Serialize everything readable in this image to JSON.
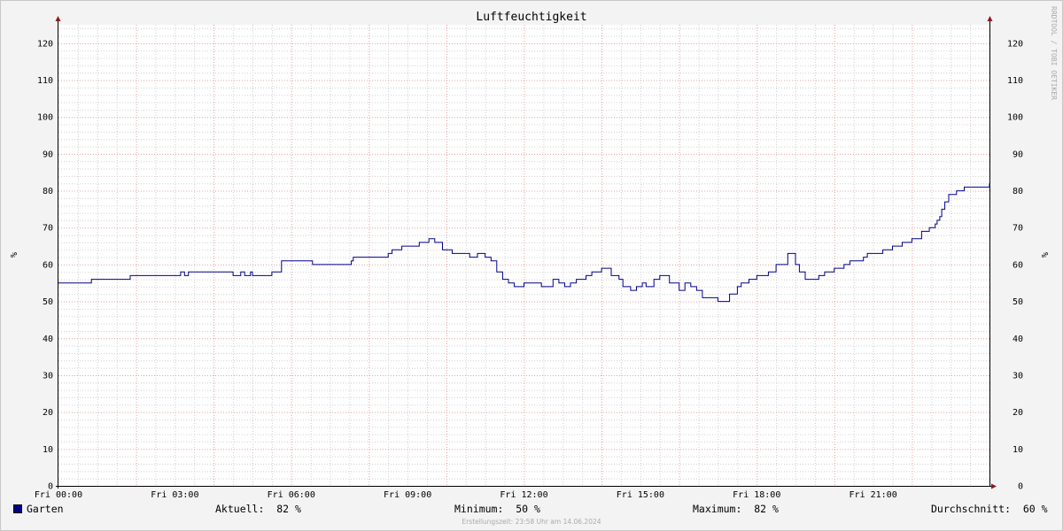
{
  "colors": {
    "background": "#f3f3f3",
    "canvas": "#ffffff",
    "major_grid": "#e6a0a0",
    "minor_grid": "#d0d0d0",
    "axis": "#000000",
    "series": "#00008b",
    "arrow": "#8b1a1a"
  },
  "watermark": "RRDTOOL / TOBI OETIKER",
  "chart_data": {
    "type": "line",
    "title": "Luftfeuchtigkeit",
    "ylabel": "%",
    "ylabel_right": "%",
    "ylim": [
      0,
      125
    ],
    "yticks": [
      0,
      10,
      20,
      30,
      40,
      50,
      60,
      70,
      80,
      90,
      100,
      110,
      120
    ],
    "xlim": [
      0,
      24
    ],
    "xticks": [
      {
        "h": 0,
        "label": "Fri 00:00"
      },
      {
        "h": 3,
        "label": "Fri 03:00"
      },
      {
        "h": 6,
        "label": "Fri 06:00"
      },
      {
        "h": 9,
        "label": "Fri 09:00"
      },
      {
        "h": 12,
        "label": "Fri 12:00"
      },
      {
        "h": 15,
        "label": "Fri 15:00"
      },
      {
        "h": 18,
        "label": "Fri 18:00"
      },
      {
        "h": 21,
        "label": "Fri 21:00"
      }
    ],
    "grid": true,
    "legend_position": "bottom",
    "series": [
      {
        "name": "Garten",
        "color": "#00008b",
        "x": [
          0,
          0.85,
          1.85,
          3.15,
          3.25,
          3.35,
          4.5,
          4.7,
          4.8,
          4.95,
          5.0,
          5.1,
          5.5,
          5.75,
          6.0,
          6.55,
          7.55,
          7.6,
          8.5,
          8.6,
          8.85,
          9.3,
          9.55,
          9.7,
          9.9,
          10.15,
          10.6,
          10.8,
          11.0,
          11.15,
          11.3,
          11.45,
          11.6,
          11.75,
          12.0,
          12.15,
          12.45,
          12.75,
          12.9,
          13.05,
          13.2,
          13.35,
          13.6,
          13.75,
          14.0,
          14.25,
          14.45,
          14.55,
          14.75,
          14.9,
          15.05,
          15.15,
          15.35,
          15.5,
          15.75,
          16.0,
          16.15,
          16.3,
          16.45,
          16.6,
          16.8,
          17.0,
          17.1,
          17.3,
          17.5,
          17.6,
          17.7,
          17.8,
          18.0,
          18.3,
          18.5,
          18.8,
          19.0,
          19.1,
          19.25,
          19.45,
          19.6,
          19.75,
          20.0,
          20.25,
          20.4,
          20.55,
          20.75,
          20.85,
          21.0,
          21.25,
          21.5,
          21.75,
          22.0,
          22.25,
          22.45,
          22.5,
          22.6,
          22.65,
          22.72,
          22.77,
          22.85,
          22.95,
          23.15,
          23.35,
          24.0
        ],
        "values": [
          55,
          56,
          57,
          58,
          57,
          58,
          57,
          58,
          57,
          58,
          57,
          57,
          58,
          61,
          61,
          60,
          61,
          62,
          63,
          64,
          65,
          66,
          67,
          66,
          64,
          63,
          62,
          63,
          62,
          61,
          58,
          56,
          55,
          54,
          55,
          55,
          54,
          56,
          55,
          54,
          55,
          56,
          57,
          58,
          59,
          57,
          56,
          54,
          53,
          54,
          55,
          54,
          56,
          57,
          55,
          53,
          55,
          54,
          53,
          51,
          51,
          50,
          50,
          52,
          54,
          55,
          55,
          56,
          57,
          58,
          60,
          63,
          60,
          58,
          56,
          56,
          57,
          58,
          59,
          60,
          61,
          61,
          62,
          63,
          63,
          64,
          65,
          66,
          67,
          69,
          70,
          70,
          71,
          72,
          73,
          75,
          77,
          79,
          80,
          81,
          82
        ]
      }
    ]
  },
  "legend": {
    "series_name": "Garten",
    "current_label": "Aktuell:",
    "current_value": "82 %",
    "min_label": "Minimum:",
    "min_value": "50 %",
    "max_label": "Maximum:",
    "max_value": "82 %",
    "avg_label": "Durchschnitt:",
    "avg_value": "60 %"
  },
  "footer": "Erstellungszeit: 23:58 Uhr am 14.06.2024"
}
